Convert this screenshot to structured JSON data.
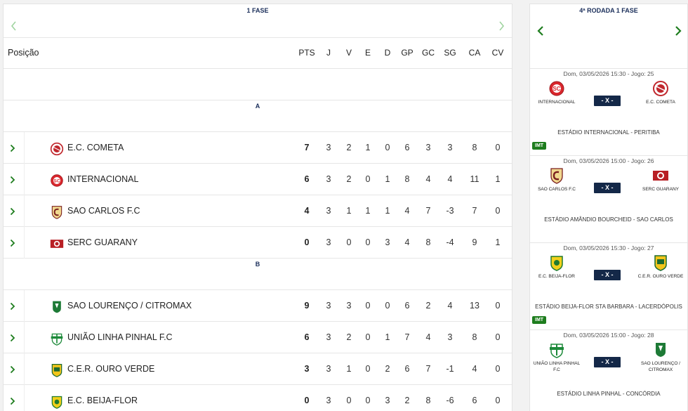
{
  "standings": {
    "phase_title": "1 FASE",
    "position_label": "Posição",
    "columns": [
      "PTS",
      "J",
      "V",
      "E",
      "D",
      "GP",
      "GC",
      "SG",
      "CA",
      "CV"
    ],
    "groups": [
      {
        "name": "A",
        "teams": [
          {
            "name": "E.C. COMETA",
            "stats": [
              "7",
              "3",
              "2",
              "1",
              "0",
              "6",
              "3",
              "3",
              "8",
              "0"
            ]
          },
          {
            "name": "INTERNACIONAL",
            "stats": [
              "6",
              "3",
              "2",
              "0",
              "1",
              "8",
              "4",
              "4",
              "11",
              "1"
            ]
          },
          {
            "name": "SAO CARLOS F.C",
            "stats": [
              "4",
              "3",
              "1",
              "1",
              "1",
              "4",
              "7",
              "-3",
              "7",
              "0"
            ]
          },
          {
            "name": "SERC GUARANY",
            "stats": [
              "0",
              "3",
              "0",
              "0",
              "3",
              "4",
              "8",
              "-4",
              "9",
              "1"
            ]
          }
        ]
      },
      {
        "name": "B",
        "teams": [
          {
            "name": "SAO LOURENÇO / CITROMAX",
            "stats": [
              "9",
              "3",
              "3",
              "0",
              "0",
              "6",
              "2",
              "4",
              "13",
              "0"
            ]
          },
          {
            "name": "UNIÃO LINHA PINHAL F.C",
            "stats": [
              "6",
              "3",
              "2",
              "0",
              "1",
              "7",
              "4",
              "3",
              "8",
              "0"
            ]
          },
          {
            "name": "C.E.R. OURO VERDE",
            "stats": [
              "3",
              "3",
              "1",
              "0",
              "2",
              "6",
              "7",
              "-1",
              "4",
              "0"
            ]
          },
          {
            "name": "E.C. BEIJA-FLOR",
            "stats": [
              "0",
              "3",
              "0",
              "0",
              "3",
              "2",
              "8",
              "-6",
              "6",
              "0"
            ]
          }
        ]
      }
    ]
  },
  "round": {
    "title": "4ª RODADA 1 FASE",
    "matches": [
      {
        "when": "Dom, 03/05/2026 15:30 - Jogo: 25",
        "home": "INTERNACIONAL",
        "away": "E.C. COMETA",
        "score": "- X -",
        "venue": "ESTÁDIO INTERNACIONAL - PERITIBA",
        "badge": "IMT"
      },
      {
        "when": "Dom, 03/05/2026 15:00 - Jogo: 26",
        "home": "SAO CARLOS F.C",
        "away": "SERC GUARANY",
        "score": "- X -",
        "venue": "ESTÁDIO AMÂNDIO BOURCHEID - SAO CARLOS",
        "badge": ""
      },
      {
        "when": "Dom, 03/05/2026 15:30 - Jogo: 27",
        "home": "E.C. BEIJA-FLOR",
        "away": "C.E.R. OURO VERDE",
        "score": "- X -",
        "venue": "ESTÁDIO BEIJA-FLOR STA BARBARA - LACERDÓPOLIS",
        "badge": "IMT"
      },
      {
        "when": "Dom, 03/05/2026 15:00 - Jogo: 28",
        "home": "UNIÃO LINHA PINHAL F.C",
        "away": "SAO LOURENÇO / CITROMAX",
        "score": "- X -",
        "venue": "ESTÁDIO LINHA PINHAL - CONCÓRDIA",
        "badge": ""
      }
    ]
  },
  "colors": {
    "accent_green": "#1e7d1e",
    "navy": "#142848",
    "arrow_light": "#9fd49f"
  }
}
